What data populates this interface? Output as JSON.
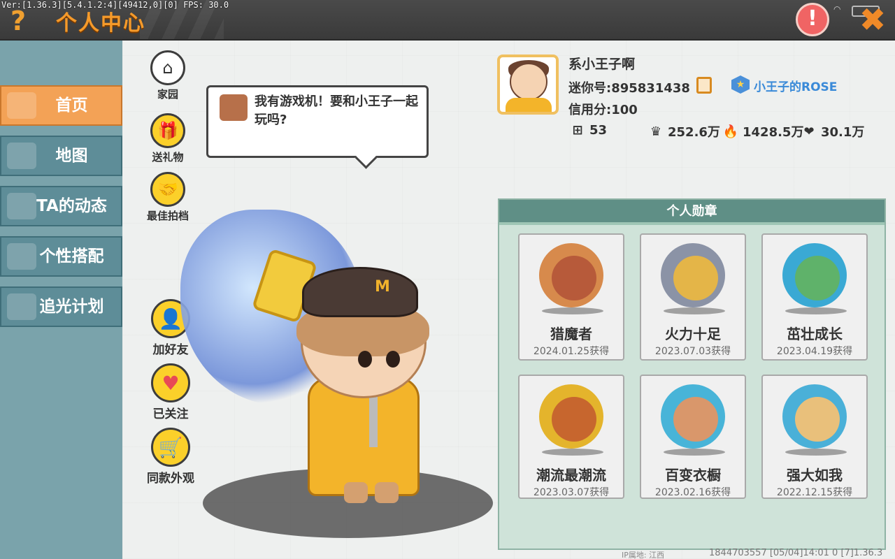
{
  "debug_text": "Ver:[1.36.3][5.4.1.2:4][49412,0][0] FPS: 30.0",
  "header": {
    "title": "个人中心",
    "help_glyph": "?",
    "warn_glyph": "!",
    "close_glyph": "✖",
    "accent": "#f59a2a"
  },
  "sidebar": {
    "items": [
      {
        "label": "首页",
        "active": true
      },
      {
        "label": "地图",
        "active": false
      },
      {
        "label": "TA的动态",
        "active": false
      },
      {
        "label": "个性搭配",
        "active": false
      },
      {
        "label": "追光计划",
        "active": false
      }
    ]
  },
  "actions": {
    "home": "家园",
    "gift": "送礼物",
    "best_shot": "最佳拍档",
    "add_friend": "加好友",
    "followed": "已关注",
    "same_outfit": "同款外观"
  },
  "bubble": {
    "text": "我有游戏机！要和小王子一起玩吗?"
  },
  "character": {
    "cap_letter": "M"
  },
  "profile": {
    "nickname": "系小王子啊",
    "mini_id": "迷你号:895831438",
    "credit": "信用分:100",
    "team_name": "小王子的ROSE",
    "stats": {
      "fans": "53",
      "popularity": "252.6万",
      "heat": "1428.5万",
      "likes": "30.1万"
    }
  },
  "medals_panel": {
    "title": "个人勋章",
    "items": [
      {
        "name": "猎魔者",
        "date": "2024.01.25获得",
        "ring": "#d78a4c",
        "core": "#b75a3a"
      },
      {
        "name": "火力十足",
        "date": "2023.07.03获得",
        "ring": "#8b93a6",
        "core": "#e4b548"
      },
      {
        "name": "茁壮成长",
        "date": "2023.04.19获得",
        "ring": "#3aa9d4",
        "core": "#5fb26a"
      },
      {
        "name": "潮流最潮流",
        "date": "2023.03.07获得",
        "ring": "#e4b42c",
        "core": "#c7662e"
      },
      {
        "name": "百变衣橱",
        "date": "2023.02.16获得",
        "ring": "#48b4d8",
        "core": "#d9976b"
      },
      {
        "name": "强大如我",
        "date": "2022.12.15获得",
        "ring": "#4ab0d8",
        "core": "#e9c07b"
      }
    ]
  },
  "footer": {
    "ip": "IP属地: 江西",
    "info": "1844703557   [05/04]14:01 0   [7]1.36.3"
  }
}
